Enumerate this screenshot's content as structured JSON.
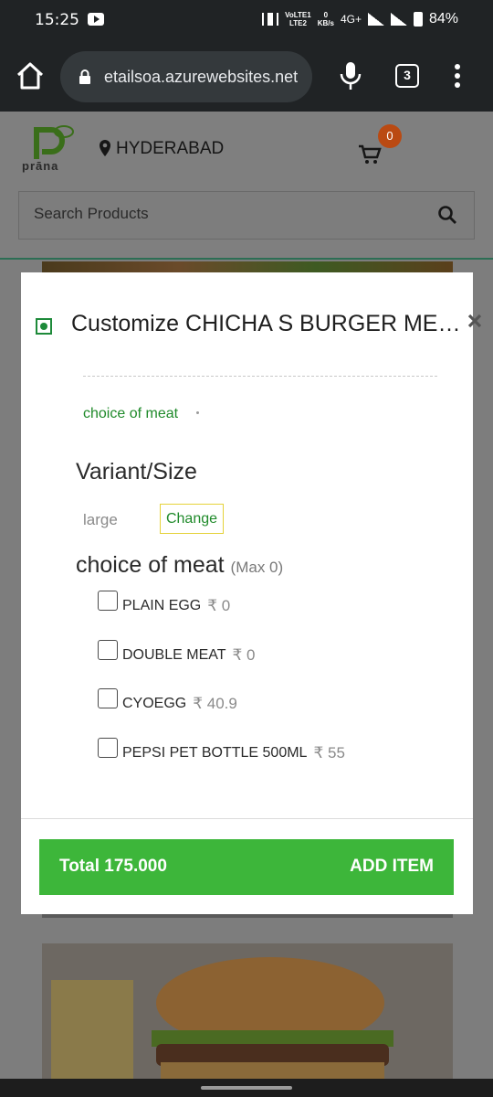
{
  "status_bar": {
    "time": "15:25",
    "net_top": "VoLTE1",
    "net_bottom": "LTE2",
    "speed_top": "0",
    "speed_bottom": "KB/s",
    "network": "4G+",
    "battery": "84%"
  },
  "browser": {
    "url": "etailsoa.azurewebsites.net",
    "tab_count": "3"
  },
  "site_header": {
    "logo_text": "prāna",
    "location": "HYDERABAD",
    "cart_count": "0",
    "search_placeholder": "Search Products"
  },
  "modal": {
    "title": "Customize CHICHA S BURGER MEAL",
    "choice_hint": "choice of meat",
    "variant_heading": "Variant/Size",
    "variant_value": "large",
    "change_label": "Change",
    "meat_heading": "choice of meat",
    "meat_max": "(Max 0)",
    "options": [
      {
        "name": "PLAIN EGG",
        "price": "₹ 0"
      },
      {
        "name": "DOUBLE MEAT",
        "price": "₹ 0"
      },
      {
        "name": "CYOEGG",
        "price": "₹ 40.9"
      },
      {
        "name": "PEPSI PET BOTTLE 500ML",
        "price": "₹ 55"
      }
    ],
    "total_label": "Total 175.000",
    "add_label": "ADD ITEM"
  },
  "colors": {
    "accent_green": "#3db63a",
    "text_green": "#1f8a2a",
    "badge": "#ba4a12",
    "browser_bg": "#202325"
  }
}
